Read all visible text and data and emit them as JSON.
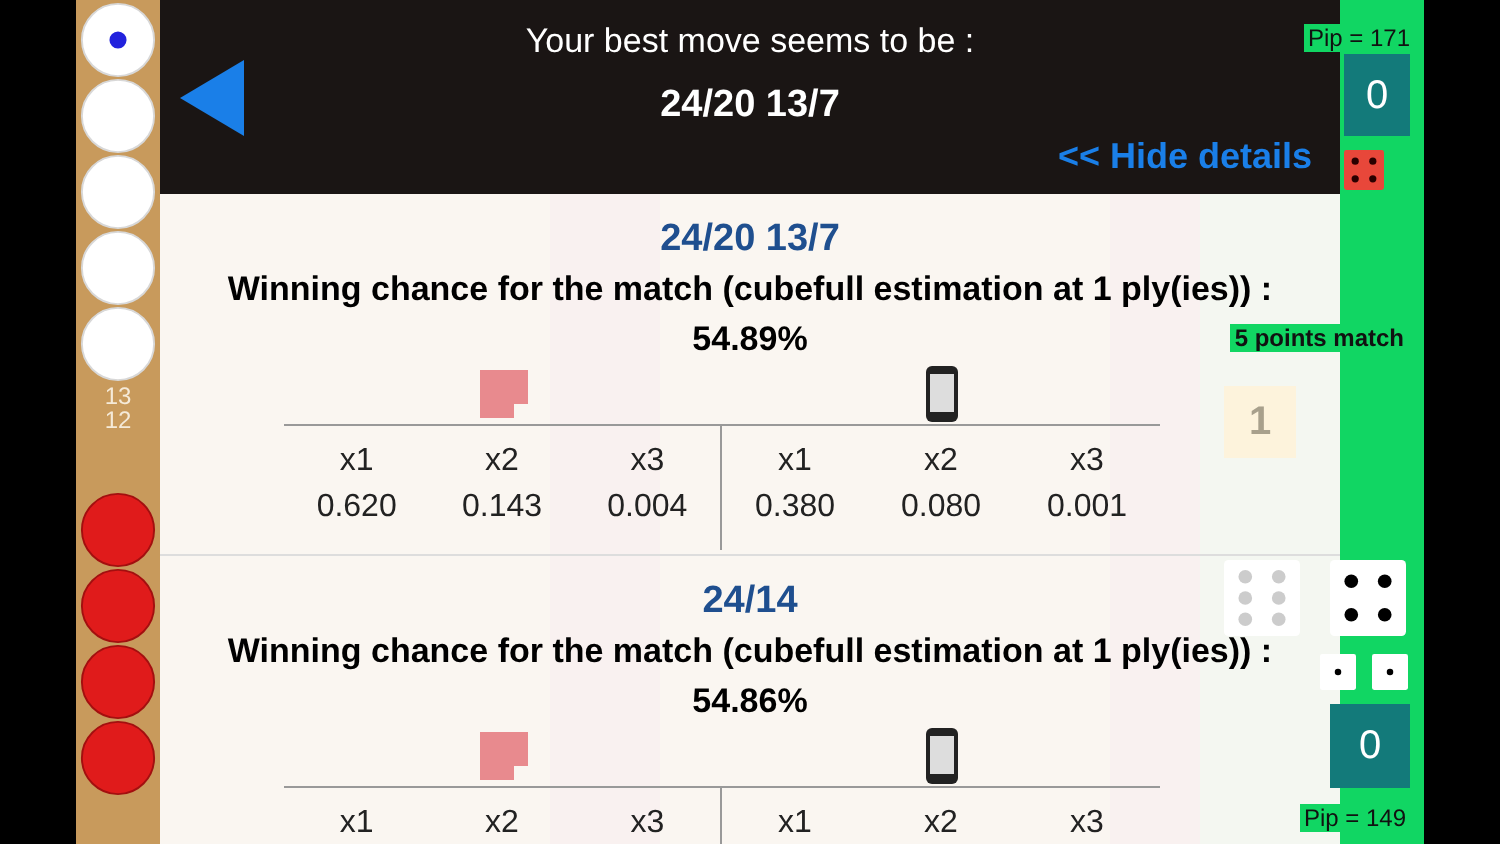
{
  "top_panel": {
    "title": "Your best move seems to be :",
    "best_move": "24/20 13/7",
    "hide_link": "<< Hide details"
  },
  "analyses": [
    {
      "move": "24/20 13/7",
      "label": "Winning chance for the match (cubefull estimation at 1 ply(ies)) :",
      "percent": "54.89%",
      "columns": [
        {
          "header": "x1",
          "value": "0.620"
        },
        {
          "header": "x2",
          "value": "0.143"
        },
        {
          "header": "x3",
          "value": "0.004"
        },
        {
          "header": "x1",
          "value": "0.380"
        },
        {
          "header": "x2",
          "value": "0.080"
        },
        {
          "header": "x3",
          "value": "0.001"
        }
      ]
    },
    {
      "move": "24/14",
      "label": "Winning chance for the match (cubefull estimation at 1 ply(ies)) :",
      "percent": "54.86%",
      "columns": [
        {
          "header": "x1"
        },
        {
          "header": "x2"
        },
        {
          "header": "x3"
        },
        {
          "header": "x1"
        },
        {
          "header": "x2"
        },
        {
          "header": "x3"
        }
      ]
    }
  ],
  "bar": {
    "top_checkers": [
      {
        "kind": "white",
        "dot": true
      },
      {
        "kind": "white",
        "dot": false
      },
      {
        "kind": "white",
        "dot": false
      },
      {
        "kind": "white",
        "dot": false
      },
      {
        "kind": "white",
        "dot": false
      }
    ],
    "point_labels": [
      "13",
      "12"
    ],
    "bottom_checkers": [
      {
        "kind": "red",
        "dot": false
      },
      {
        "kind": "red",
        "dot": false
      },
      {
        "kind": "red",
        "dot": false
      },
      {
        "kind": "red",
        "dot": false
      }
    ]
  },
  "side": {
    "top_pip": "Pip = 171",
    "top_score": "0",
    "match": "5 points match",
    "cube": "1",
    "bottom_score": "0",
    "bottom_pip": "Pip = 149"
  }
}
